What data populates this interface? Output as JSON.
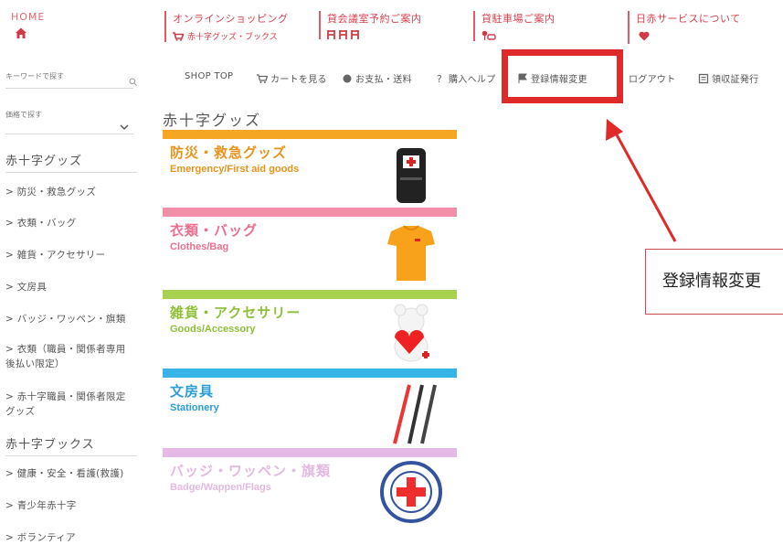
{
  "topnav": {
    "home": {
      "label": "HOME",
      "icon": "home-icon"
    },
    "shopping": {
      "label": "オンラインショッピング",
      "sub": "赤十字グッズ・ブックス",
      "icon": "cart-icon"
    },
    "meeting": {
      "label": "貸会議室予約ご案内",
      "icon": "chairs-icon"
    },
    "parking": {
      "label": "貸駐車場ご案内",
      "icon": "parking-icon"
    },
    "service": {
      "label": "日赤サービスについて",
      "icon": "heart-icon"
    }
  },
  "sidebar": {
    "keyword_label": "キーワードで探す",
    "other_label": "価格で探す",
    "section1": "赤十字グッズ",
    "items1": [
      "> 防災・救急グッズ",
      "> 衣類・バッグ",
      "> 雑貨・アクセサリー",
      "> 文房具",
      "> バッジ・ワッペン・旗類",
      "> 衣類（職員・関係者専用 後払い限定）",
      "> 赤十字職員・関係者限定 グッズ"
    ],
    "section2": "赤十字ブックス",
    "items2": [
      "> 健康・安全・看護(救護)",
      "> 青少年赤十字",
      "> ボランティア"
    ]
  },
  "toolbar": {
    "shop_top": "SHOP TOP",
    "cart": "カートを見る",
    "payment": "お支払・送料",
    "help": "購入ヘルプ",
    "register": "登録情報変更",
    "logout": "ログアウト",
    "receipt": "領収証発行"
  },
  "page_title": "赤十字グッズ",
  "categories": [
    {
      "ja": "防災・救急グッズ",
      "en": "Emergency/First aid goods",
      "color": "#f5a623",
      "text_color": "#e8931c",
      "icon": "backpack-image"
    },
    {
      "ja": "衣類・バッグ",
      "en": "Clothes/Bag",
      "color": "#f28fa8",
      "text_color": "#ee6f8d",
      "icon": "tshirt-image"
    },
    {
      "ja": "雑貨・アクセサリー",
      "en": "Goods/Accessory",
      "color": "#a8d14f",
      "text_color": "#8fbf36",
      "icon": "teddy-bear-image"
    },
    {
      "ja": "文房具",
      "en": "Stationery",
      "color": "#39b4e6",
      "text_color": "#2a9ed6",
      "icon": "pens-image"
    },
    {
      "ja": "バッジ・ワッペン・旗類",
      "en": "Badge/Wappen/Flags",
      "color": "#e4b6e4",
      "text_color": "#e2b7de",
      "icon": "red-cross-emblem-image"
    }
  ],
  "annotation": {
    "note": "登録情報変更",
    "color": "#e02a2a"
  }
}
